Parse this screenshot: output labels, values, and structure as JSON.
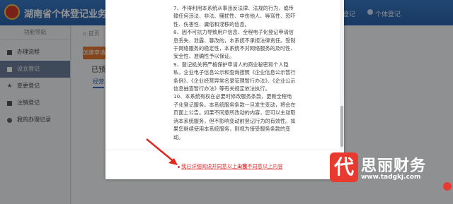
{
  "header": {
    "title": "湖南省个体登记业务全程电子化系统",
    "links": [
      "登记",
      "个体登记"
    ]
  },
  "sidebar": {
    "title": "功能导航",
    "items": [
      {
        "label": "办理流程",
        "icon": "doc-icon"
      },
      {
        "label": "设立登记",
        "icon": "doc-icon",
        "active": true
      },
      {
        "label": "变更登记",
        "icon": "star-icon"
      },
      {
        "label": "注销登记",
        "icon": "flag-icon"
      },
      {
        "label": "我的办理记录",
        "icon": "circle-icon"
      }
    ]
  },
  "main": {
    "breadcrumb": "首页",
    "create_button": "创建申请",
    "section_title": "已预先",
    "subtab": "经营"
  },
  "modal": {
    "terms": [
      "7、不得利用本系统从事违反法律、法规的行为，或传输任何违法、非法、骚扰性、中伤他人、辱骂性、恐吓性、伤害性、庸俗和淫秽的信息。",
      "8、因不可抗力导致用户信息、全程电子化登记申请信息丢失、泄露、篡改的，本系统不承担法律责任。受制于网络服务的稳定性，本系统不对网络服务的及时性、安全性、准确性予以保证。",
      "9、登记机关将严格保护申请人的商业秘密和个人隐私，企业电子信息公示和查询按照《企业信息公示暂行条例》、《企业经营异常名录管理暂行办法》、《企业公示信息抽查暂行办法》等有关规定依法执行。",
      "10、本系统有权在必要时修改服务条款，更新全程电子化登记服务。本系统服务条款一旦发生变动，将会在页面上公告。如果不同意所改动的内容，您可以主动取消本系统服务，但不影响变动前登记行为的有效性。如果您继续使用本系统服务，则视为接受服务条款的变动。"
    ],
    "agree_label": "我已详细阅读并同意以上内容",
    "disagree_label": "我不同意以上内容"
  },
  "watermark": {
    "logo_char": "代",
    "name": "思丽财务",
    "url": "www.tadgkj.com"
  },
  "colors": {
    "header_blue": "#2a63aa",
    "accent_orange": "#e3782f",
    "link_red": "#dd3333",
    "brand_red": "#e83a2e"
  }
}
